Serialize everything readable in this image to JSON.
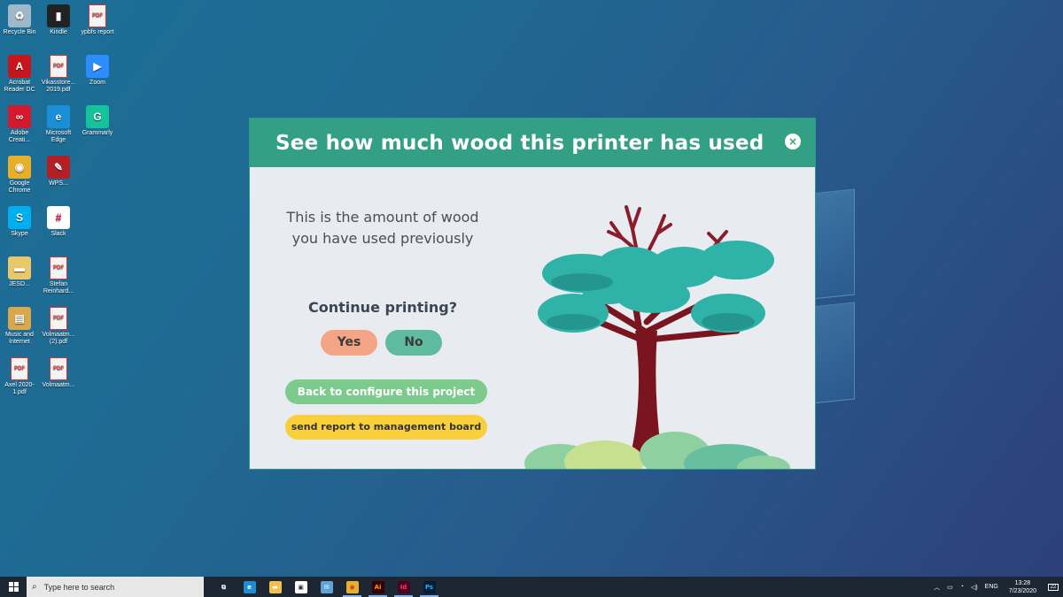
{
  "desktop": {
    "icons": [
      {
        "label": "Recycle Bin",
        "icon": "recycle-bin-icon"
      },
      {
        "label": "Kindle",
        "icon": "kindle-icon"
      },
      {
        "label": "ypbfs report",
        "icon": "pdf-file-icon"
      },
      {
        "label": "Acrobat Reader DC",
        "icon": "acrobat-reader-icon"
      },
      {
        "label": "Vikasstore... 2019.pdf",
        "icon": "pdf-file-icon"
      },
      {
        "label": "Zoom",
        "icon": "zoom-icon"
      },
      {
        "label": "Adobe Creati...",
        "icon": "adobe-creative-cloud-icon"
      },
      {
        "label": "Microsoft Edge",
        "icon": "edge-icon"
      },
      {
        "label": "Grammarly",
        "icon": "grammarly-icon"
      },
      {
        "label": "Google Chrome",
        "icon": "chrome-icon"
      },
      {
        "label": "WPS...",
        "icon": "quill-icon"
      },
      {
        "label": "Skype",
        "icon": "skype-icon"
      },
      {
        "label": "Slack",
        "icon": "slack-icon"
      },
      {
        "label": "JESD...",
        "icon": "folder-icon"
      },
      {
        "label": "Stefan Reinhard...",
        "icon": "pdf-file-icon"
      },
      {
        "label": "Music and Internet",
        "icon": "archive-icon"
      },
      {
        "label": "Volmaatm... (2).pdf",
        "icon": "pdf-file-icon"
      },
      {
        "label": "Axel 2020-1.pdf",
        "icon": "pdf-file-icon"
      },
      {
        "label": "Volmaatm...",
        "icon": "pdf-file-icon"
      }
    ]
  },
  "dialog": {
    "title": "See how much wood this printer has used",
    "close_icon": "×",
    "amount_text": "This is the amount of wood you have used previously",
    "question": "Continue printing?",
    "yes_label": "Yes",
    "no_label": "No",
    "back_label": "Back to configure this project",
    "report_label": "send report to management board",
    "colors": {
      "header": "#33a086",
      "yes": "#f4a585",
      "no": "#5fbb9e",
      "back": "#7dcb8c",
      "report": "#f9cf3c"
    }
  },
  "taskbar": {
    "search_placeholder": "Type here to search",
    "apps": [
      {
        "icon": "task-view-icon",
        "label": ""
      },
      {
        "icon": "edge-icon",
        "label": ""
      },
      {
        "icon": "file-explorer-icon",
        "label": ""
      },
      {
        "icon": "store-icon",
        "label": ""
      },
      {
        "icon": "mail-icon",
        "label": ""
      },
      {
        "icon": "chrome-icon",
        "label": ""
      },
      {
        "icon": "illustrator-icon",
        "label": "Ai"
      },
      {
        "icon": "indesign-icon",
        "label": "Id"
      },
      {
        "icon": "photoshop-icon",
        "label": "Ps"
      }
    ],
    "language": "ENG",
    "time": "13:28",
    "date": "7/23/2020",
    "notification_count": "22"
  }
}
